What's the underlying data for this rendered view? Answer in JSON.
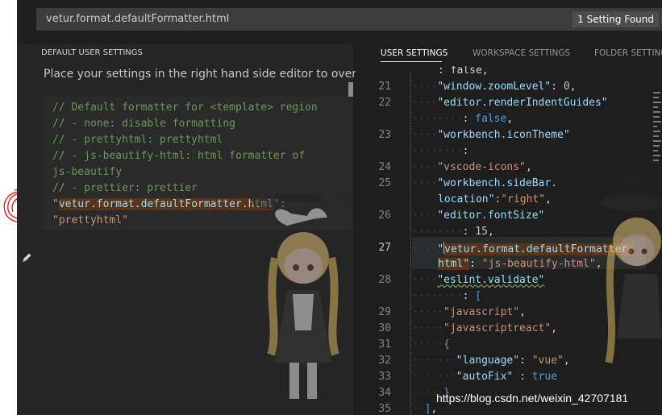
{
  "search": {
    "query": "vetur.format.defaultFormatter.html",
    "result_badge": "1 Setting Found"
  },
  "left_pane": {
    "title": "DEFAULT USER SETTINGS",
    "description": "Place your settings in the right hand side editor to override.",
    "comments": [
      "// Default formatter for <template> region",
      "//  - none: disable formatting",
      "//  - prettyhtml: prettyhtml",
      "//  - js-beautify-html: html formatter of",
      "js-beautify",
      "//  - prettier: prettier"
    ],
    "setting_key": "vetur.format.defaultFormatter.html",
    "setting_value": "\"prettyhtml\""
  },
  "right_pane": {
    "tabs": [
      {
        "label": "USER SETTINGS",
        "active": true
      },
      {
        "label": "WORKSPACE SETTINGS",
        "active": false
      },
      {
        "label": "FOLDER SETTINGS",
        "active": false
      }
    ],
    "lines": {
      "prev_tail": ": false,",
      "l21": {
        "num": "21",
        "key": "\"window.zoomLevel\"",
        "value": "0"
      },
      "l22": {
        "num": "22",
        "key": "\"editor.renderIndentGuides\"",
        "value": "false"
      },
      "l23": {
        "num": "23",
        "key": "\"workbench.iconTheme\""
      },
      "l24": {
        "num": "24",
        "value": "\"vscode-icons\""
      },
      "l25": {
        "num": "25",
        "key_a": "\"workbench.sideBar.",
        "key_b": "location\"",
        "value": "\"right\""
      },
      "l26": {
        "num": "26",
        "key": "\"editor.fontSize\"",
        "value": "15"
      },
      "l27": {
        "num": "27",
        "key_a": "vetur.format.defaultFormatter.",
        "key_b": "html\"",
        "value": "\"js-beautify-html\""
      },
      "l28": {
        "num": "28",
        "key": "\"eslint.validate\""
      },
      "l29": {
        "num": "29",
        "value": "\"javascript\""
      },
      "l30": {
        "num": "30",
        "value": "\"javascriptreact\""
      },
      "l31": {
        "num": "31"
      },
      "l32": {
        "num": "32",
        "key": "\"language\"",
        "value": "\"vue\""
      },
      "l33": {
        "num": "33",
        "key": "\"autoFix\"",
        "value": "true"
      },
      "l34": {
        "num": "34"
      },
      "l35": {
        "num": "35"
      }
    }
  },
  "watermark": "https://blog.csdn.net/weixin_42707181",
  "colors": {
    "comment": "#6a9955",
    "key": "#9cdcfe",
    "string": "#ce9178",
    "number": "#b5cea8",
    "keyword": "#569cd6",
    "highlight": "#5a3417"
  }
}
